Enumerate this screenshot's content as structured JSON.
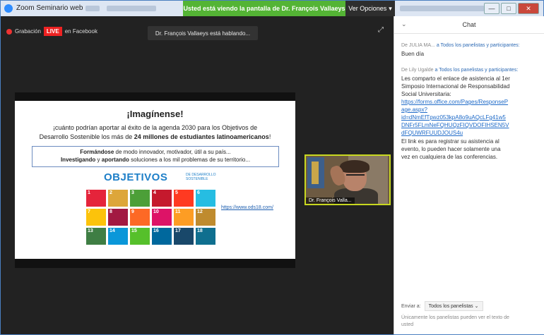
{
  "window": {
    "title": "Zoom Seminario web",
    "share_banner": "Usted está viendo la pantalla de Dr. François Vallaeys",
    "view_options": "Ver Opciones",
    "view_options_icon": "chevron-down-icon",
    "minimize": "—",
    "maximize": "□",
    "close": "✕"
  },
  "video": {
    "recording_label": "Grabación",
    "live_badge": "LIVE",
    "live_platform": "en Facebook",
    "speaking_banner": "Dr. François Vallaeys está hablando...",
    "expand_icon": "expand-icon",
    "self_view_name": "Dr. François Valla..."
  },
  "slide": {
    "title": "¡Imagínense!",
    "question_line1": "¡cuánto podrían aportar al éxito de la agenda 2030 para los Objetivos de",
    "question_line2_pre": "Desarrollo Sostenible los más de ",
    "question_line2_bold": "24 millones de estudiantes latinoamericanos",
    "question_line2_post": "!",
    "box_line1_bold": "Formándose",
    "box_line1_rest": " de modo innovador, motivador, útil a su país...",
    "box_line2_bold1": "Investigando",
    "box_line2_mid": " y ",
    "box_line2_bold2": "aportando",
    "box_line2_rest": " soluciones a los mil problemas de su territorio...",
    "sdg_title": "OBJETIVOS",
    "sdg_subtitle": "DE DESARROLLO SOSTENIBLE",
    "link": "https://www.ods18.com/",
    "sdg_tiles": [
      {
        "n": "1",
        "color": "#e5243b"
      },
      {
        "n": "2",
        "color": "#dda63a"
      },
      {
        "n": "3",
        "color": "#4c9f38"
      },
      {
        "n": "4",
        "color": "#c5192d"
      },
      {
        "n": "5",
        "color": "#ff3a21"
      },
      {
        "n": "6",
        "color": "#26bde2"
      },
      {
        "n": "7",
        "color": "#fcc30b"
      },
      {
        "n": "8",
        "color": "#a21942"
      },
      {
        "n": "9",
        "color": "#fd6925"
      },
      {
        "n": "10",
        "color": "#dd1367"
      },
      {
        "n": "11",
        "color": "#fd9d24"
      },
      {
        "n": "12",
        "color": "#bf8b2e"
      },
      {
        "n": "13",
        "color": "#3f7e44"
      },
      {
        "n": "14",
        "color": "#0a97d9"
      },
      {
        "n": "15",
        "color": "#56c02b"
      },
      {
        "n": "16",
        "color": "#00689d"
      },
      {
        "n": "17",
        "color": "#19486a"
      },
      {
        "n": "18",
        "color": "#0f6f8f"
      }
    ]
  },
  "chat": {
    "title": "Chat",
    "collapse_icon": "chevron-down-icon",
    "messages": [
      {
        "from": "De JULIA MA...",
        "to": "a Todos los panelistas y participantes:",
        "lines": [
          "Buen día"
        ]
      },
      {
        "from": "De Lily Ugalde",
        "to": "a Todos los panelistas y participantes:",
        "lines": [
          "Les comparto el enlace de asistencia al 1er",
          "Simposio Internacional de Responsabilidad",
          "Social Universitaria:"
        ],
        "link_lines": [
          "https://forms.office.com/Pages/ResponseP",
          "age.aspx?",
          "id=dNmEfTpwz053kpA8o9uAQcLFg41w5",
          "DNFr5FLmNeFQHUQzFIQVDOFIHSEN5V",
          "dFQUWRFUUDJOUS4u"
        ],
        "after_lines": [
          "El link es para registrar su asistencia al",
          "evento, lo pueden hacer solamente una",
          "vez en cualquiera de las conferencias."
        ]
      }
    ],
    "send_to_label": "Enviar a:",
    "send_to_value": "Todos los panelistas",
    "input_placeholder_line1": "Únicamente los panelistas pueden ver el texto de",
    "input_placeholder_line2": "usted"
  }
}
